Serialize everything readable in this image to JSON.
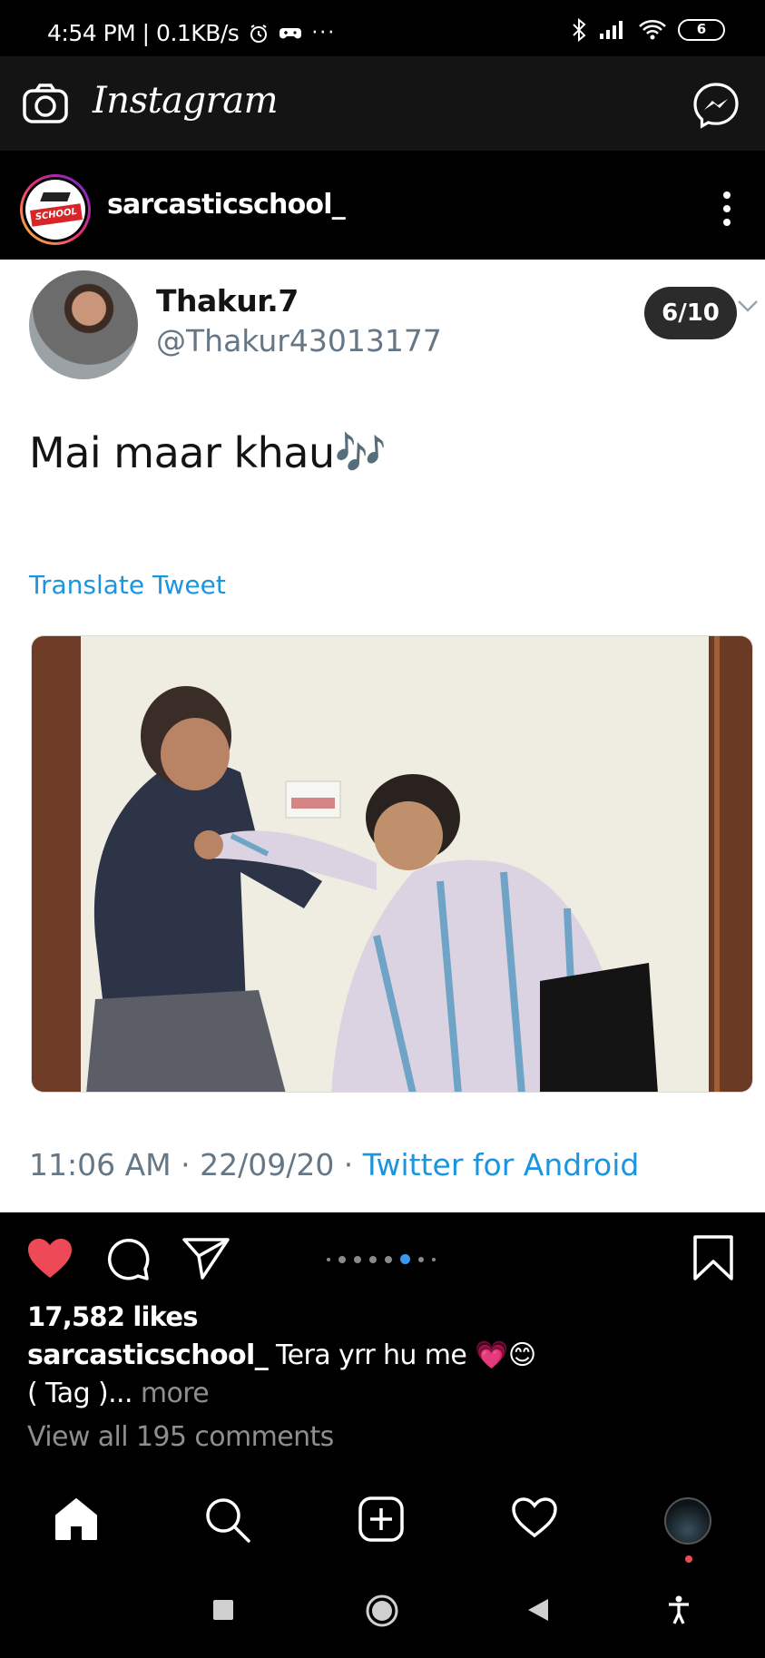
{
  "status_bar": {
    "left_text": "4:54 PM | 0.1KB/s",
    "battery": "6",
    "icons": [
      "alarm-icon",
      "gamepad-icon",
      "more-dots-icon",
      "bluetooth-icon",
      "signal-icon",
      "wifi-icon",
      "battery-icon"
    ]
  },
  "app_header": {
    "title": "Instagram",
    "icons": [
      "camera-icon",
      "messenger-icon"
    ]
  },
  "post": {
    "username": "sarcasticschool_",
    "avatar_badge": "SCHOOL",
    "carousel_counter": "6/10",
    "carousel_active_index": 5,
    "carousel_dots": 8
  },
  "tweet": {
    "name": "Thakur.7",
    "handle": "@Thakur43013177",
    "text": "Mai maar khau🎶",
    "translate_label": "Translate Tweet",
    "timestamp": "11:06 AM · 22/09/20 · ",
    "source": "Twitter for Android"
  },
  "actions": {
    "liked": true,
    "accent_color": "#ed4956"
  },
  "engagement": {
    "likes": "17,582 likes",
    "caption_user": "sarcasticschool_",
    "caption_text": " Tera yrr hu me 💗😊",
    "caption_line2": "( Tag )...",
    "more_label": " more",
    "view_comments": "View all 195 comments"
  },
  "bottom_nav": {
    "items": [
      "home-icon",
      "search-icon",
      "new-post-icon",
      "activity-icon",
      "profile-icon"
    ]
  },
  "system_nav": {
    "items": [
      "recents-icon",
      "home-circle-icon",
      "back-icon",
      "accessibility-icon"
    ]
  }
}
